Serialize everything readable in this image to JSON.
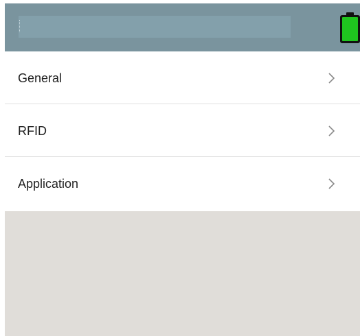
{
  "header": {
    "title": "",
    "background_color": "#7a949e",
    "battery": {
      "icon": "battery-icon",
      "level": 1.0,
      "fill_color": "#1fc51f"
    }
  },
  "menu": {
    "items": [
      {
        "label": "General",
        "icon": "chevron-right-icon"
      },
      {
        "label": "RFID",
        "icon": "chevron-right-icon"
      },
      {
        "label": "Application",
        "icon": "chevron-right-icon"
      }
    ]
  },
  "colors": {
    "empty_area": "#e0ddd9",
    "divider": "#dedede",
    "text": "#222222"
  }
}
